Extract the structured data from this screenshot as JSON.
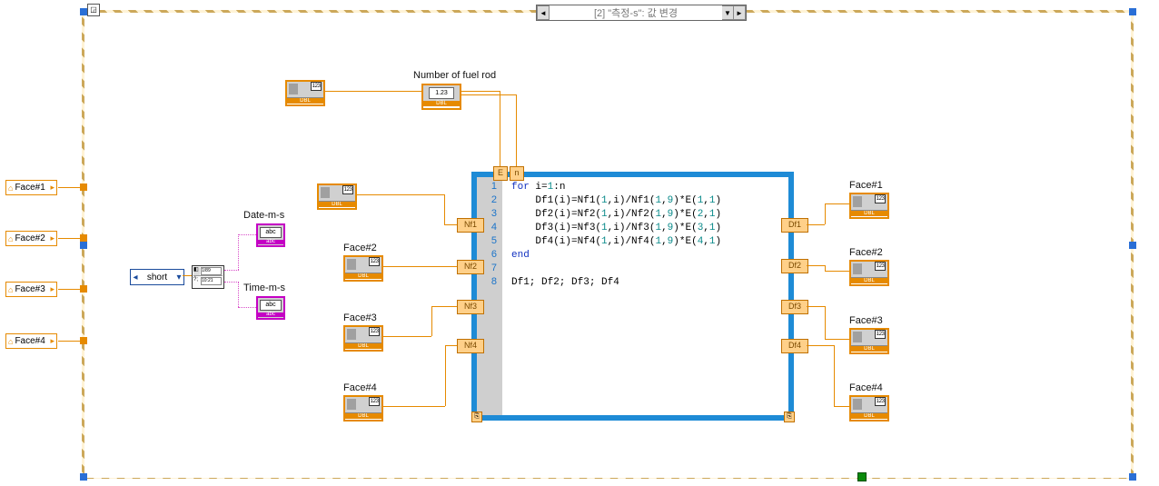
{
  "case": {
    "selector_label": "[2] \"측정-s\": 값 변경",
    "arrow_left": "◄",
    "arrow_right": "►",
    "dropdown": "▼"
  },
  "outer_locals": [
    "Face#1",
    "Face#2",
    "Face#3",
    "Face#4"
  ],
  "enum": {
    "value": "short"
  },
  "datetime": {
    "date_label": "Date-m-s",
    "time_label": "Time-m-s"
  },
  "constant_label": "Number of fuel rod",
  "inputs": {
    "e_term": "E",
    "n_term": "n",
    "nf": [
      "Nf1",
      "Nf2",
      "Nf3",
      "Nf4"
    ],
    "face_labels": [
      "Face#2",
      "Face#3",
      "Face#4"
    ]
  },
  "outputs": {
    "df": [
      "Df1",
      "Df2",
      "Df3",
      "Df4"
    ],
    "face_labels": [
      "Face#1",
      "Face#2",
      "Face#3",
      "Face#4"
    ]
  },
  "code": {
    "line_numbers": [
      "1",
      "2",
      "3",
      "4",
      "5",
      "6",
      "7",
      "8"
    ],
    "text": "for i=1:n\n    Df1(i)=Nf1(1,i)/Nf1(1,9)*E(1,1)\n    Df2(i)=Nf2(1,i)/Nf2(1,9)*E(2,1)\n    Df3(i)=Nf3(1,i)/Nf3(1,9)*E(3,1)\n    Df4(i)=Nf4(1,i)/Nf4(1,9)*E(4,1)\nend\n\nDf1; Df2; Df3; Df4"
  },
  "array_tag": "DBL",
  "abc_tag": "abc",
  "knob_tag": "1.23"
}
